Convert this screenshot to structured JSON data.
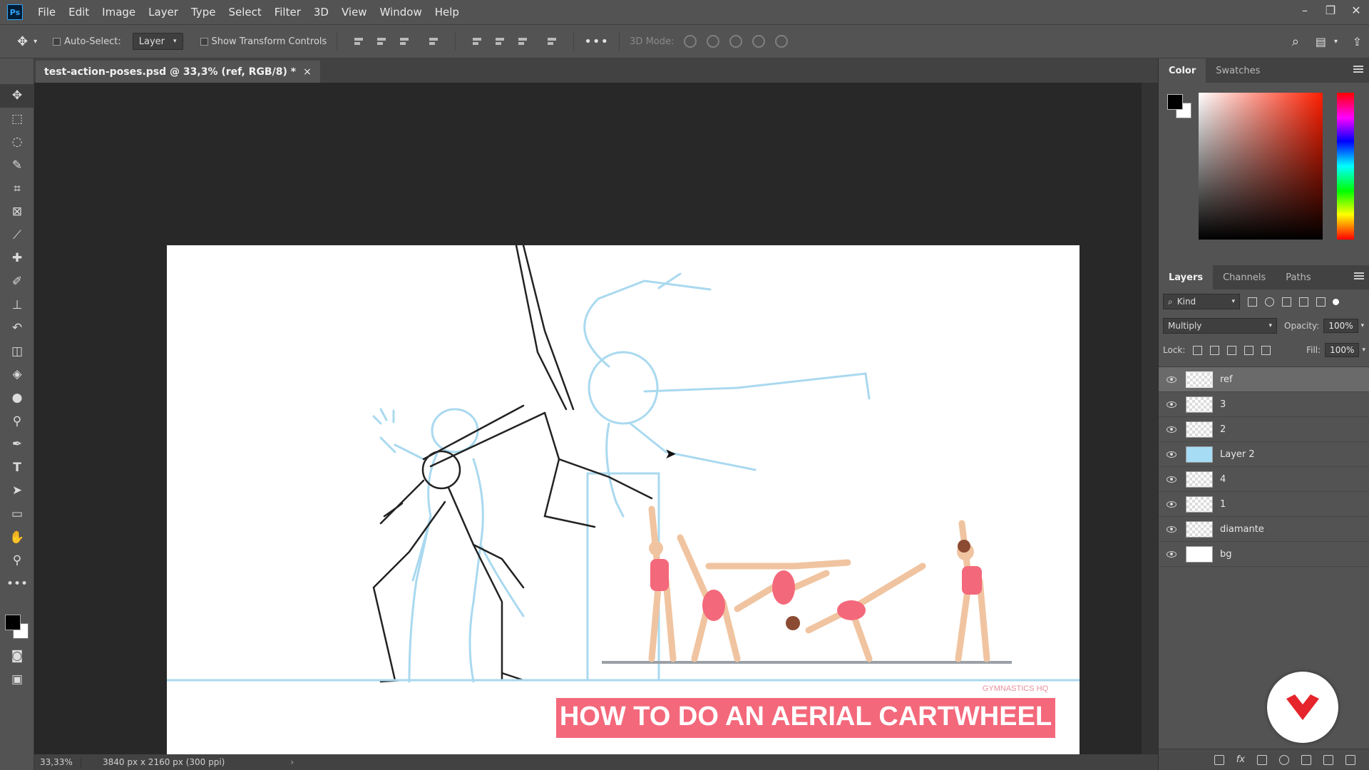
{
  "menubar": {
    "logo": "Ps",
    "items": [
      "File",
      "Edit",
      "Image",
      "Layer",
      "Type",
      "Select",
      "Filter",
      "3D",
      "View",
      "Window",
      "Help"
    ]
  },
  "options": {
    "auto_select_label": "Auto-Select:",
    "auto_select_target": "Layer",
    "show_transform_label": "Show Transform Controls",
    "three_d_mode_label": "3D Mode:"
  },
  "document": {
    "tab_title": "test-action-poses.psd @ 33,3% (ref, RGB/8) *",
    "close_glyph": "×",
    "zoom": "33,33%",
    "info": "3840 px x 2160 px (300 ppi)",
    "artwork": {
      "banner_text": "HOW TO DO AN AERIAL CARTWHEEL",
      "watermark": "GYMNASTICS HQ",
      "sketch_color": "#a9d9ef",
      "banner_color": "#f4687b"
    }
  },
  "color_panel": {
    "tabs": [
      "Color",
      "Swatches"
    ],
    "foreground": "#000000",
    "background": "#ffffff"
  },
  "layers_panel": {
    "tabs": [
      "Layers",
      "Channels",
      "Paths"
    ],
    "kind_label": "Kind",
    "blend_mode": "Multiply",
    "opacity_label": "Opacity:",
    "opacity_value": "100%",
    "lock_label": "Lock:",
    "fill_label": "Fill:",
    "fill_value": "100%",
    "layers": [
      {
        "name": "ref",
        "selected": true
      },
      {
        "name": "3"
      },
      {
        "name": "2"
      },
      {
        "name": "Layer 2",
        "thumb": "#a7dcf5"
      },
      {
        "name": "4"
      },
      {
        "name": "1"
      },
      {
        "name": "diamante"
      },
      {
        "name": "bg",
        "thumb": "#ffffff"
      }
    ]
  }
}
